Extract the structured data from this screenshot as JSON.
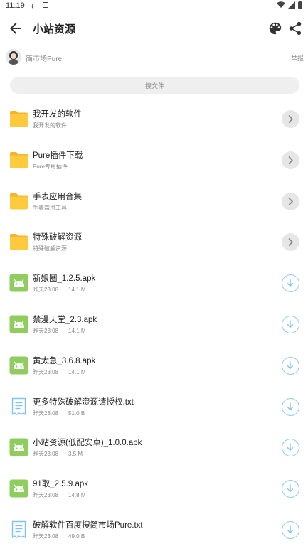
{
  "status": {
    "time": "11:19"
  },
  "header": {
    "title": "小站资源"
  },
  "author": {
    "name": "简市场Pure",
    "report_label": "举报"
  },
  "search": {
    "placeholder": "搜文件"
  },
  "items": [
    {
      "name": "我开发的软件",
      "sub": "我开发的软件",
      "type": "folder"
    },
    {
      "name": "Pure插件下载",
      "sub": "Pure专用插件",
      "type": "folder"
    },
    {
      "name": "手表应用合集",
      "sub": "手表常用工具",
      "type": "folder"
    },
    {
      "name": "特殊破解资源",
      "sub": "特殊破解资源",
      "type": "folder"
    },
    {
      "name": "新娘圈_1.2.5.apk",
      "date": "昨天23:08",
      "size": "14.1 M",
      "type": "apk"
    },
    {
      "name": "禁漫天堂_2.3.apk",
      "date": "昨天23:08",
      "size": "14.1 M",
      "type": "apk"
    },
    {
      "name": "黄太急_3.6.8.apk",
      "date": "昨天23:08",
      "size": "14.1 M",
      "type": "apk"
    },
    {
      "name": "更多特殊破解资源请授权.txt",
      "date": "昨天23:08",
      "size": "51.0 B",
      "type": "txt"
    },
    {
      "name": "小站资源(低配安卓)_1.0.0.apk",
      "date": "昨天23:08",
      "size": "3.5 M",
      "type": "apk"
    },
    {
      "name": "91取_2.5.9.apk",
      "date": "昨天23:08",
      "size": "14.8 M",
      "type": "apk"
    },
    {
      "name": "破解软件百度搜简市场Pure.txt",
      "date": "昨天23:08",
      "size": "49.0 B",
      "type": "txt"
    }
  ],
  "colors": {
    "folder": "#ffcb3d",
    "apk": "#8fce5e",
    "txt": "#7fc4f0",
    "accent": "#8ec9f0"
  }
}
